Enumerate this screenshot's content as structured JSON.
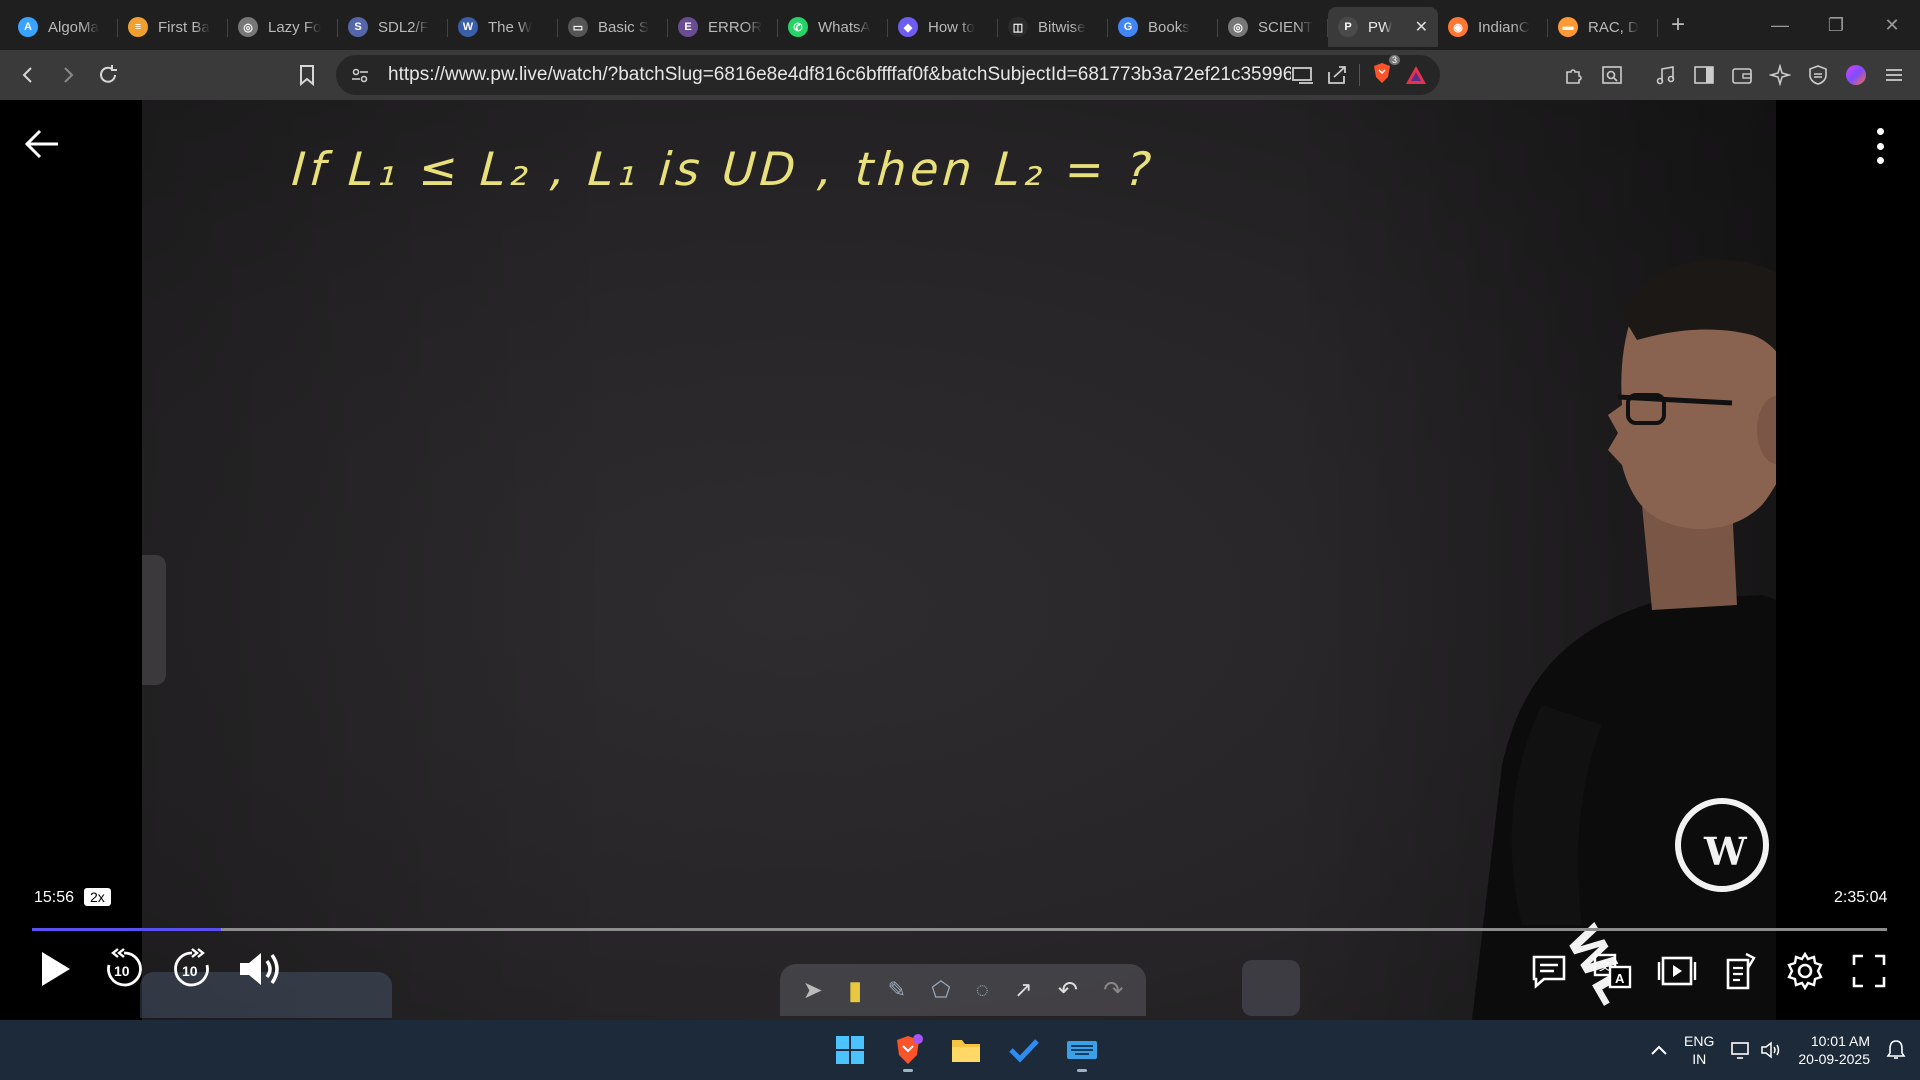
{
  "browser": {
    "tabs": [
      {
        "label": "AlgoMa",
        "color": "#3aa3ff",
        "glyph": "A"
      },
      {
        "label": "First Ba",
        "color": "#f0a030",
        "glyph": "≡"
      },
      {
        "label": "Lazy Fo",
        "color": "#777777",
        "glyph": "◎"
      },
      {
        "label": "SDL2/F",
        "color": "#5566aa",
        "glyph": "S"
      },
      {
        "label": "The W",
        "color": "#3a5ea8",
        "glyph": "W"
      },
      {
        "label": "Basic S",
        "color": "#555555",
        "glyph": "▭"
      },
      {
        "label": "ERROR",
        "color": "#6a4c93",
        "glyph": "E"
      },
      {
        "label": "WhatsA",
        "color": "#25d366",
        "glyph": "✆"
      },
      {
        "label": "How to",
        "color": "#6f5cf0",
        "glyph": "◆"
      },
      {
        "label": "Bitwise",
        "color": "#2b2b2b",
        "glyph": "◫"
      },
      {
        "label": "Books",
        "color": "#4285f4",
        "glyph": "G"
      },
      {
        "label": "SCIENT",
        "color": "#777777",
        "glyph": "◎"
      },
      {
        "label": "PW",
        "color": "#4a4a4a",
        "glyph": "P",
        "active": true
      },
      {
        "label": "IndianC",
        "color": "#ff7733",
        "glyph": "◉"
      },
      {
        "label": "RAC, D",
        "color": "#ff9933",
        "glyph": "▬"
      }
    ],
    "new_tab": "+",
    "url": "https://www.pw.live/watch/?batchSlug=6816e8e4df816c6bffffaf0f&batchSubjectId=681773b3a72ef21c3599634...",
    "brave_badge": "3",
    "accent": "#5a4ff0"
  },
  "video": {
    "board_text": "If  L₁ ≤ L₂ ,  L₁ is  UD ,  then  L₂ = ?",
    "logo_text": "PW",
    "current_time": "15:56",
    "speed": "2x",
    "duration": "2:35:04",
    "progress_fraction": 0.102
  },
  "taskbar": {
    "lang_line1": "ENG",
    "lang_line2": "IN",
    "time": "10:01 AM",
    "date": "20-09-2025"
  }
}
